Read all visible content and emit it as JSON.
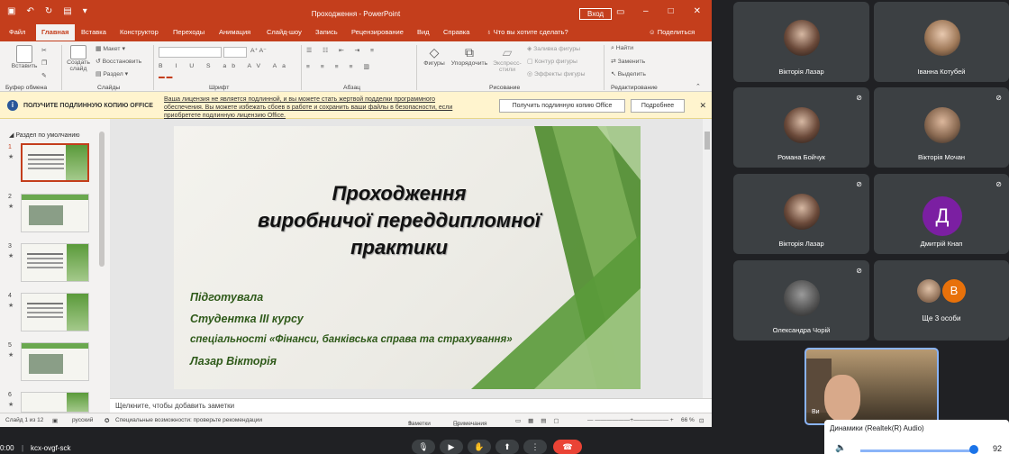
{
  "ppt": {
    "window_title": "Проходження - PowerPoint",
    "login_button": "Вход",
    "tabs": [
      "Файл",
      "Главная",
      "Вставка",
      "Конструктор",
      "Переходы",
      "Анимация",
      "Слайд-шоу",
      "Запись",
      "Рецензирование",
      "Вид",
      "Справка"
    ],
    "tell_me": "Что вы хотите сделать?",
    "share": "Поделиться",
    "ribbon": {
      "paste": "Вставить",
      "new_slide": "Создать слайд",
      "layout": "Макет",
      "reset": "Восстановить",
      "section": "Раздел",
      "shapes": "Фигуры",
      "arrange": "Упорядочить",
      "quick_styles": "Экспресс-стили",
      "fill": "Заливка фигуры",
      "outline": "Контур фигуры",
      "effects": "Эффекты фигуры",
      "find": "Найти",
      "replace": "Заменить",
      "select": "Выделить",
      "groups": {
        "clipboard": "Буфер обмена",
        "slides": "Слайды",
        "font": "Шрифт",
        "paragraph": "Абзац",
        "drawing": "Рисование",
        "editing": "Редактирование"
      }
    },
    "infobar": {
      "title": "ПОЛУЧИТЕ ПОДЛИННУЮ КОПИЮ OFFICE",
      "message": "Ваша лицензия не является подлинной, и вы можете стать жертвой подделки программного обеспечения. Вы можете избежать сбоев в работе и сохранить ваши файлы в безопасности, если приобретете подлинную лицензию Office.",
      "get_button": "Получить подлинную копию Office",
      "more_button": "Подробнее"
    },
    "section_label": "Раздел по умолчанию",
    "thumb_numbers": [
      "1",
      "2",
      "3",
      "4",
      "5",
      "6"
    ],
    "slide": {
      "title_lines": [
        "Проходження",
        "виробничої переддипломної",
        "практики"
      ],
      "lines": [
        "Підготувала",
        "Студентка ІІІ курсу",
        "спеціальності «Фінанси, банківська справа та страхування»",
        "Лазар Вікторія"
      ]
    },
    "notes_placeholder": "Щелкните, чтобы добавить заметки",
    "status": {
      "slide": "Слайд 1 из 12",
      "lang": "русский",
      "accessibility": "Специальные возможности: проверьте рекомендации",
      "notes": "Заметки",
      "comments": "Примечания",
      "zoom": "66 %"
    }
  },
  "participants": [
    {
      "name": "Вікторія Лазар"
    },
    {
      "name": "Іванна Котубей"
    },
    {
      "name": "Романа Бойчук"
    },
    {
      "name": "Вікторія Мочан"
    },
    {
      "name": "Вікторія Лазар"
    },
    {
      "name": "Дмитрій Кнап",
      "initial": "Д"
    },
    {
      "name": "Олександра Чорій"
    },
    {
      "name": "Ще 3 особи",
      "initial": "В"
    }
  ],
  "self_view_label": "Ви",
  "audio": {
    "device": "Динамики (Realtek(R) Audio)",
    "volume": "92"
  },
  "meeting": {
    "time": "0:00",
    "code": "kcx-ovgf-sck"
  },
  "colors": {
    "ppt_accent": "#c43e1c",
    "meet_bg": "#202124",
    "tile_bg": "#3c4043",
    "end_call": "#ea4335",
    "slide_green": "#5a9a3a"
  }
}
